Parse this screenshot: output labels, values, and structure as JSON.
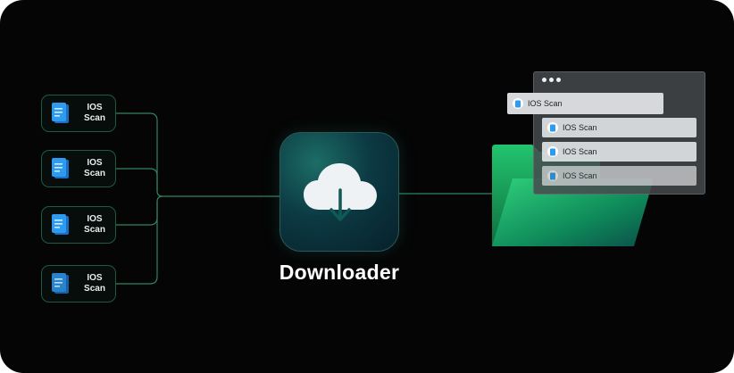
{
  "sources": [
    {
      "label": "IOS Scan",
      "icon": "document-icon"
    },
    {
      "label": "IOS Scan",
      "icon": "document-icon"
    },
    {
      "label": "IOS Scan",
      "icon": "document-icon"
    },
    {
      "label": "IOS Scan",
      "icon": "document-icon"
    }
  ],
  "app": {
    "name": "Downloader",
    "icon": "cloud-download-icon"
  },
  "destination": {
    "icon": "folder-icon",
    "window_files": [
      {
        "label": "IOS Scan"
      },
      {
        "label": "IOS Scan"
      },
      {
        "label": "IOS Scan"
      },
      {
        "label": "IOS Scan"
      }
    ]
  },
  "colors": {
    "accent": "#2fbf7a",
    "background": "#050505",
    "connector": "#3fa878"
  }
}
